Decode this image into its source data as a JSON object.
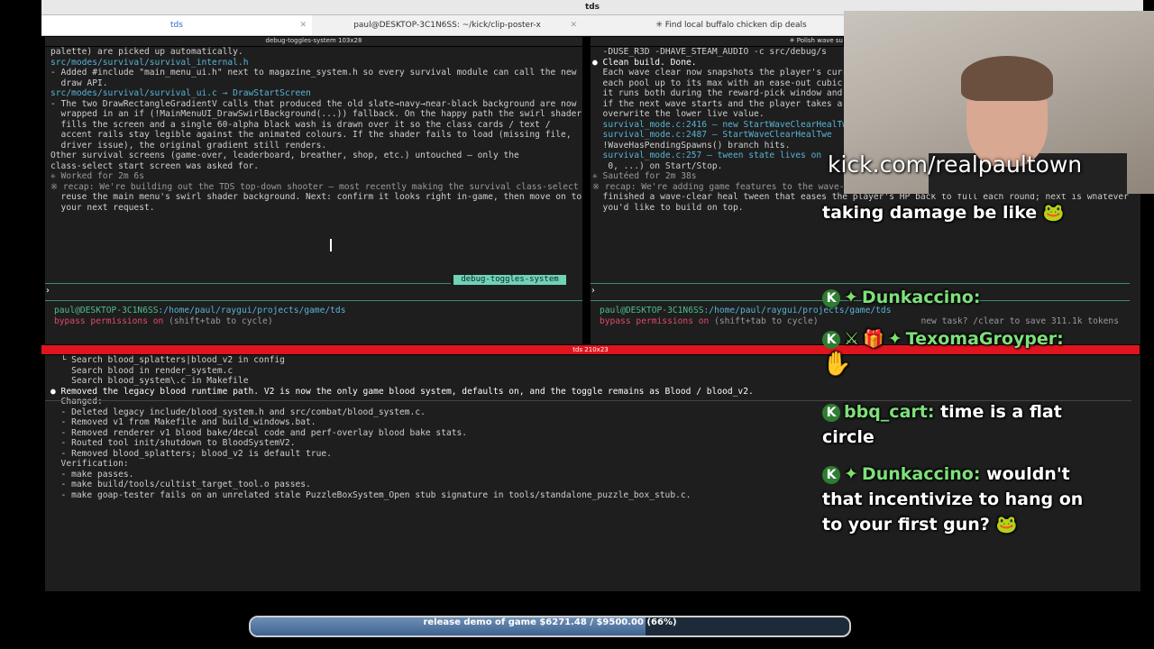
{
  "window_title": "tds",
  "tabs": [
    {
      "label": "tds",
      "active": true
    },
    {
      "label": "paul@DESKTOP-3C1N6SS: ~/kick/clip-poster-x",
      "active": false
    },
    {
      "label": "✳ Find local buffalo chicken dip deals",
      "active": false
    }
  ],
  "pane_left": {
    "header": "debug-toggles-system 103x28",
    "lines": [
      "palette) are picked up automatically.",
      "",
      "src/modes/survival/survival_internal.h",
      "- Added #include \"main_menu_ui.h\" next to magazine_system.h so every survival module can call the new",
      "  draw API.",
      "",
      "src/modes/survival/survival_ui.c → DrawStartScreen",
      "- The two DrawRectangleGradientV calls that produced the old slate→navy→near-black background are now",
      "  wrapped in an if (!MainMenuUI_DrawSwirlBackground(...)) fallback. On the happy path the swirl shader",
      "  fills the screen and a single 60-alpha black wash is drawn over it so the class cards / text /",
      "  accent rails stay legible against the animated colours. If the shader fails to load (missing file,",
      "  driver issue), the original gradient still renders.",
      "",
      "Other survival screens (game-over, leaderboard, breather, shop, etc.) untouched — only the",
      "class-select start screen was asked for.",
      "",
      "✳ Worked for 2m 6s",
      "",
      "※ recap: We're building out the TDS top-down shooter — most recently making the survival class-select",
      "  reuse the main menu's swirl shader background. Next: confirm it looks right in-game, then move on to",
      "  your next request."
    ],
    "tag": "debug-toggles-system",
    "prompt_char": "›",
    "path_user": "paul@DESKTOP-3C1N6SS",
    "path_dir": ":/home/paul/raygui/projects/game/tds",
    "bypass": "bypass permissions on",
    "bypass_hint": " (shift+tab to cycle)"
  },
  "pane_right": {
    "header": "✳ Polish wave su",
    "lines": [
      "  -DUSE_R3D -DHAVE_STEAM_AUDIO -c src/debug/s",
      "",
      "● Clean build. Done.",
      "",
      "  Each wave clear now snapshots the player's curr",
      "  each pool up to its max with an ease-out cubic.",
      "  it runs both during the reward-pick window and",
      "  if the next wave starts and the player takes a",
      "  overwrite the lower live value.",
      "",
      "  survival_mode.c:2416 — new StartWaveClearHealTw",
      "  survival_mode.c:2487 — StartWaveClearHealTwe",
      "  !WaveHasPendingSpawns() branch hits.",
      "  survival_mode.c:257 — tween state lives on",
      "   0, ...) on Start/Stop.",
      "",
      "✳ Sautéed for 2m 38s",
      "",
      "※ recap: We're adding game features to the wave-survival mode in this raylib top-down shooter. Just",
      "  finished a wave-clear heal tween that eases the player's HP back to full each round; next is whatever",
      "  you'd like to build on top."
    ],
    "prompt_char": "›",
    "path_user": "paul@DESKTOP-3C1N6SS",
    "path_dir": ":/home/paul/raygui/projects/game/tds",
    "bypass": "bypass permissions on",
    "bypass_hint": " (shift+tab to cycle)",
    "tokens_hint": "new task? /clear to save 311.1k tokens"
  },
  "bottom_bar_label": "tds 210x23",
  "pane_bottom": {
    "lines": [
      "  └ Search blood_splatters|blood_v2 in config",
      "    Search blood in render_system.c",
      "    Search blood_system\\.c in Makefile",
      "",
      "",
      "● Removed the legacy blood runtime path. V2 is now the only game blood system, defaults on, and the toggle remains as Blood / blood_v2.",
      "",
      "  Changed:",
      "",
      "  - Deleted legacy include/blood_system.h and src/combat/blood_system.c.",
      "  - Removed v1 from Makefile and build_windows.bat.",
      "  - Removed renderer v1 blood bake/decal code and perf-overlay blood bake stats.",
      "  - Routed tool init/shutdown to BloodSystemV2.",
      "  - Removed blood_splatters; blood_v2 is default true.",
      "",
      "  Verification:",
      "",
      "  - make passes.",
      "  - make build/tools/cultist_target_tool.o passes.",
      "  - make goap-tester fails on an unrelated stale PuzzleBoxSystem_Open stub signature in tools/standalone_puzzle_box_stub.c."
    ]
  },
  "overlay": {
    "url": "kick.com/realpaultown",
    "chat": [
      {
        "user": "",
        "message": "taking damage be like"
      },
      {
        "user": "Dunkaccino:",
        "message": ""
      },
      {
        "user": "TexomaGroyper:",
        "message": ""
      },
      {
        "user": "bbq_cart:",
        "message": "time is a flat circle"
      },
      {
        "user": "Dunkaccino:",
        "message": "wouldn't that incentivize to hang on to your first gun?"
      }
    ]
  },
  "goal_bar": {
    "label": "release demo of game $6271.48 / $9500.00 (66%)",
    "progress": 0.66
  }
}
